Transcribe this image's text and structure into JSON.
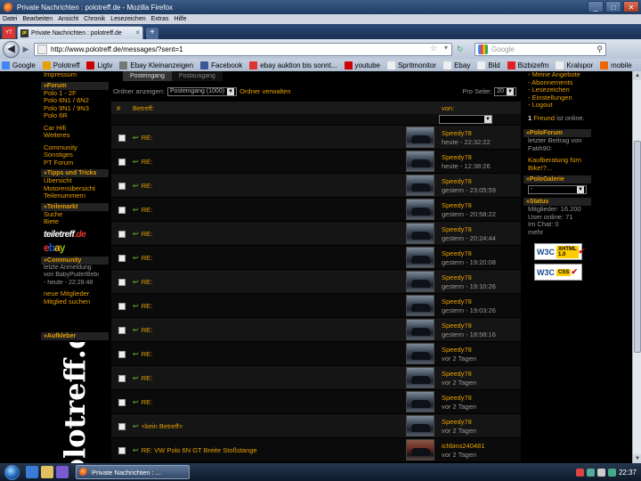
{
  "window": {
    "title": "Private Nachrichten : polotreff.de - Mozilla Firefox",
    "buttons": {
      "minimize": "_",
      "maximize": "□",
      "close": "✕"
    }
  },
  "menu": [
    "Datei",
    "Bearbeiten",
    "Ansicht",
    "Chronik",
    "Lesezeichen",
    "Extras",
    "Hilfe"
  ],
  "tabs": {
    "pinned_label": "YT",
    "active_title": "Private Nachrichten : polotreff.de",
    "active_favicon": "pt"
  },
  "navigation": {
    "url": "http://www.polotreff.de/messages/?sent=1",
    "search_placeholder": "Google"
  },
  "bookmarks": [
    {
      "label": "Google",
      "color": "#4285f4"
    },
    {
      "label": "Polotreff",
      "color": "#e8a000"
    },
    {
      "label": "Ligtv",
      "color": "#c00"
    },
    {
      "label": "Ebay Kleinanzeigen",
      "color": "#777"
    },
    {
      "label": "Facebook",
      "color": "#3b5998"
    },
    {
      "label": "ebay auktion bis sonnt...",
      "color": "#d33"
    },
    {
      "label": "youtube",
      "color": "#c00"
    },
    {
      "label": "Spritmonitor",
      "color": "#eee"
    },
    {
      "label": "Ebay",
      "color": "#eee"
    },
    {
      "label": "Bild",
      "color": "#eee"
    },
    {
      "label": "Bizbizefm",
      "color": "#d22"
    },
    {
      "label": "Kralspor",
      "color": "#eee"
    },
    {
      "label": "mobile",
      "color": "#e60"
    }
  ],
  "left_nav": {
    "top_link": "Impressum",
    "sections": [
      {
        "title": "Forum",
        "links": [
          "Polo 1 - 2F",
          "Polo 6N1 / 6N2",
          "Polo 9N1 / 9N3",
          "Polo 6R"
        ],
        "extra": [
          "Car Hifi",
          "Weiteres"
        ],
        "extra2": [
          "Community",
          "Sonstiges",
          "PT Forum"
        ]
      },
      {
        "title": "Tipps und Tricks",
        "links": [
          "Übersicht",
          "Motorenübersicht",
          "Teilenummern"
        ]
      },
      {
        "title": "Teilemarkt",
        "links": [
          "Suche",
          "Biete"
        ]
      }
    ],
    "teiletreff_logo": {
      "main": "teiletreff",
      "suffix": ".de"
    },
    "ebay_logo": [
      "e",
      "b",
      "a",
      "y"
    ],
    "community": {
      "title": "Community",
      "last_login_label": "letzte Anmeldung",
      "last_login_user": "von BabyPuderBebi",
      "last_login_time": "- heute - 22:28:48",
      "new_members": "neue Mitglieder",
      "search_members": "Mitglied suchen"
    },
    "sticker_title": "Aufkleber",
    "sticker_text": "polotreff.de"
  },
  "main": {
    "folder_tabs": [
      "Posteingang",
      "Postausgang"
    ],
    "filter": {
      "show_label": "Ordner anzeigen:",
      "selected_folder": "Posteingang (1000)",
      "manage_link": "Ordner verwalten",
      "per_page_label": "Pro Seite:",
      "per_page_value": "20"
    },
    "columns": {
      "num": "#",
      "subject": "Betreff:",
      "from": "von:"
    },
    "messages": [
      {
        "subject": "RE:",
        "sender": "Speedy78",
        "date": "heute - 22:32:22",
        "thumb": "dark"
      },
      {
        "subject": "RE:",
        "sender": "Speedy78",
        "date": "heute - 12:38:26",
        "thumb": "dark"
      },
      {
        "subject": "RE:",
        "sender": "Speedy78",
        "date": "gestern - 23:05:59",
        "thumb": "dark"
      },
      {
        "subject": "RE:",
        "sender": "Speedy78",
        "date": "gestern - 20:58:22",
        "thumb": "dark"
      },
      {
        "subject": "RE:",
        "sender": "Speedy78",
        "date": "gestern - 20:24:44",
        "thumb": "dark"
      },
      {
        "subject": "RE:",
        "sender": "Speedy78",
        "date": "gestern - 19:20:08",
        "thumb": "dark"
      },
      {
        "subject": "RE:",
        "sender": "Speedy78",
        "date": "gestern - 19:10:26",
        "thumb": "dark"
      },
      {
        "subject": "RE:",
        "sender": "Speedy78",
        "date": "gestern - 19:03:26",
        "thumb": "dark"
      },
      {
        "subject": "RE:",
        "sender": "Speedy78",
        "date": "gestern - 18:58:16",
        "thumb": "dark"
      },
      {
        "subject": "RE:",
        "sender": "Speedy78",
        "date": "vor 2 Tagen",
        "thumb": "dark"
      },
      {
        "subject": "RE:",
        "sender": "Speedy78",
        "date": "vor 2 Tagen",
        "thumb": "dark"
      },
      {
        "subject": "RE:",
        "sender": "Speedy78",
        "date": "vor 2 Tagen",
        "thumb": "dark"
      },
      {
        "subject": "<kein Betreff>",
        "sender": "Speedy78",
        "date": "vor 2 Tagen",
        "thumb": "dark"
      },
      {
        "subject": "RE: VW Polo 6N GT Breite Stoßstange",
        "sender": "ichbins240481",
        "date": "vor 2 Tagen",
        "thumb": "red"
      }
    ]
  },
  "right_nav": {
    "links": [
      "Meine Angebote",
      "Abonnements",
      "Lesezeichen",
      "Einstellungen",
      "Logout"
    ],
    "online": {
      "count": "1",
      "label": "Freund",
      "suffix": "ist online."
    },
    "poloforum": {
      "title": "PoloForum",
      "text1": "letzter Beitrag von",
      "text2": "Fatih90:",
      "link1": "Kaufberatung fürn",
      "link2": "Bike!?..."
    },
    "pologalerie": {
      "title": "PoloGalerie",
      "select": "-"
    },
    "status": {
      "title": "Status",
      "members": "Mitglieder: 16.200",
      "users_online": "User online: 71",
      "in_chat": "Im Chat: 0",
      "more": "mehr"
    },
    "badges": [
      {
        "w3c": "W3C",
        "label": "XHTML 1.0"
      },
      {
        "w3c": "W3C",
        "label": "CSS"
      }
    ]
  },
  "taskbar": {
    "task_title": "Private Nachrichten : ...",
    "clock": "22:37"
  }
}
